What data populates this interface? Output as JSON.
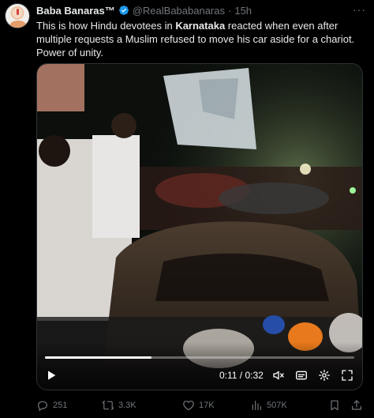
{
  "author": {
    "name": "Baba Banaras™",
    "handle": "@RealBababanaras",
    "separator": "·",
    "time": "15h",
    "more_label": "···"
  },
  "tweet": {
    "text_before": "This is how Hindu devotees in ",
    "text_bold": "Karnataka",
    "text_after": " reacted when even after multiple requests a Muslim refused to move his car aside for a chariot. Power of unity."
  },
  "video": {
    "current_time": "0:11",
    "duration": "0:32",
    "timecode": "0:11 / 0:32",
    "progress": 0.344
  },
  "metrics": {
    "replies": "251",
    "reposts": "3.3K",
    "likes": "17K",
    "views": "507K"
  },
  "colors": {
    "background": "#000000",
    "text": "#e7e9ea",
    "muted": "#71767b",
    "verified": "#1d9bf0"
  }
}
